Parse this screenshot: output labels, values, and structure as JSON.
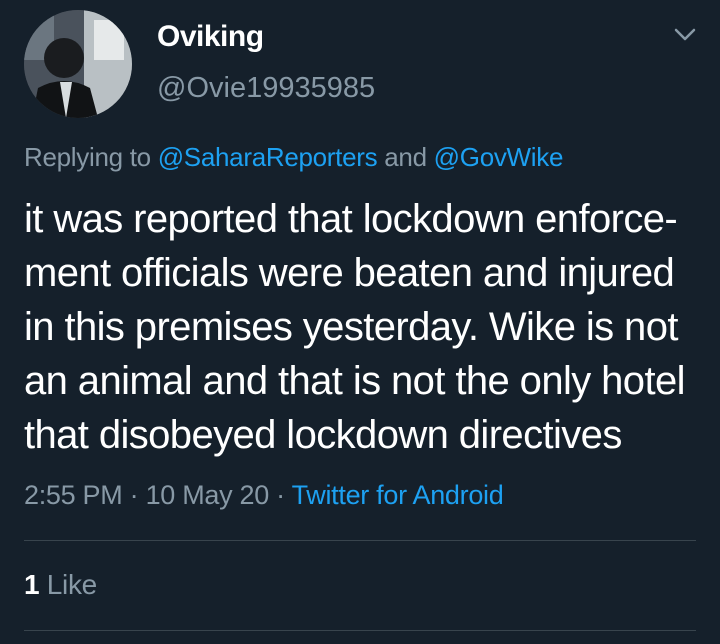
{
  "author": {
    "display_name": "Oviking",
    "handle": "@Ovie19935985"
  },
  "reply": {
    "prefix": "Replying to",
    "mention1": "@SaharaReporters",
    "conjunction": "and",
    "mention2": "@GovWike"
  },
  "tweet": {
    "lines": [
      "it was reported that lockdown enforce-",
      "ment officials were  beaten and injured",
      "in this premises yesterday. Wike is not",
      "an animal and that is not the only hotel",
      "that disobeyed lockdown directives"
    ]
  },
  "meta": {
    "time": "2:55 PM",
    "separator": "·",
    "date": "10 May 20",
    "source": "Twitter for Android"
  },
  "stats": {
    "like_count": "1",
    "like_label": "Like"
  },
  "icons": {
    "caret": "chevron-down-icon",
    "avatar": "avatar"
  },
  "colors": {
    "background": "#15202b",
    "text": "#ffffff",
    "secondary": "#8899a6",
    "link": "#1da1f2",
    "divider": "#38444d"
  }
}
